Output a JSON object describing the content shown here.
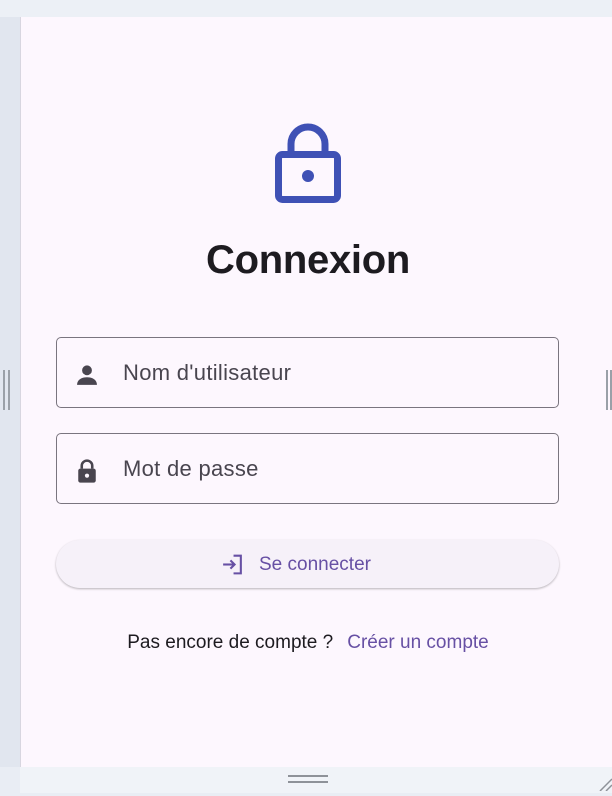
{
  "login": {
    "title": "Connexion",
    "username": {
      "placeholder": "Nom d'utilisateur",
      "icon": "person-icon"
    },
    "password": {
      "placeholder": "Mot de passe",
      "icon": "lock-icon"
    },
    "submit": {
      "label": "Se connecter",
      "icon": "login-icon"
    },
    "signup": {
      "question": "Pas encore de compte ?",
      "link": "Créer un compte"
    }
  },
  "colors": {
    "brand_icon": "#3f51b5",
    "accent": "#6750a4",
    "background": "#fdf7fe",
    "text": "#1d1b20"
  }
}
